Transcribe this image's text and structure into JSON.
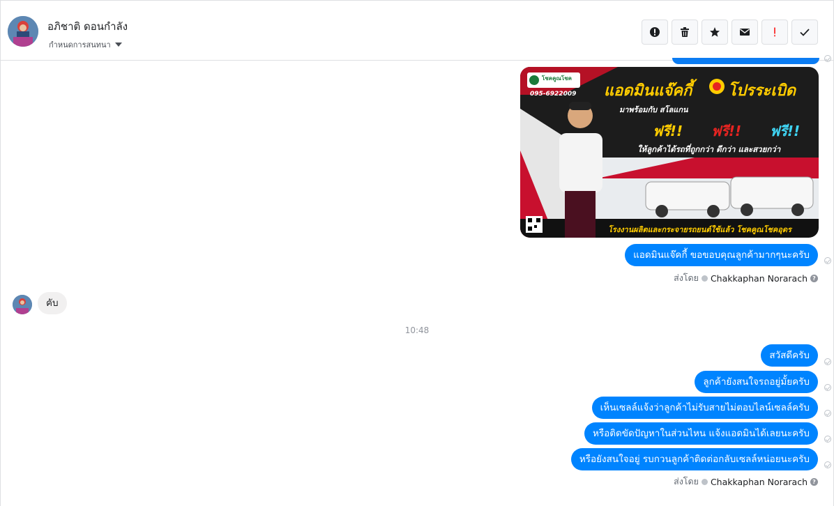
{
  "header": {
    "contact_name": "อภิชาติ ดอนกำลัง",
    "subtitle": "กำหนดการสนทนา",
    "toolbar": [
      {
        "name": "alert-icon"
      },
      {
        "name": "trash-icon"
      },
      {
        "name": "star-icon"
      },
      {
        "name": "envelope-icon"
      },
      {
        "name": "exclamation-icon"
      },
      {
        "name": "check-icon"
      }
    ]
  },
  "promo_image": {
    "brand": "โชคคูณโชค",
    "phone": "095-6922009",
    "headline": "แอดมินแจ๊คกี้",
    "headline_tail": "โปรระเบิด",
    "subheadline": "มาพร้อมกับ สโลแกน",
    "free": [
      "ฟรี!!",
      "ฟรี!!",
      "ฟรี!!"
    ],
    "tagline": "ให้ลูกค้าได้รถที่ถูกกว่า ดีกว่า และสวยกว่า",
    "footer": "โรงงานผลิตและกระจายรถยนต์ใช้แล้ว โชคคูณโชคอุดร"
  },
  "messages": {
    "thanks": "แอดมินแจ๊คกี้ ขอขอบคุณลูกค้ามากๆนะครับ",
    "sent_by_label": "ส่งโดย",
    "sender": "Chakkaphan Norarach",
    "incoming": "คับ",
    "time": "10:48",
    "out1": "สวัสดีครับ",
    "out2": "ลูกค้ายังสนใจรถอยู่มั้ยครับ",
    "out3": "เห็นเซลล์แจ้งว่าลูกค้าไม่รับสายไม่ตอบไลน์เซลล์ครับ",
    "out4": "หรือติดขัดปัญหาในส่วนไหน แจ้งแอดมินได้เลยนะครับ",
    "out5": "หรือยังสนใจอยู่ รบกวนลูกค้าติดต่อกลับเซลล์หน่อยนะครับ"
  },
  "colors": {
    "bubble_out": "#0084ff",
    "bubble_in": "#f1f0f0",
    "promo_red": "#c8102e"
  }
}
